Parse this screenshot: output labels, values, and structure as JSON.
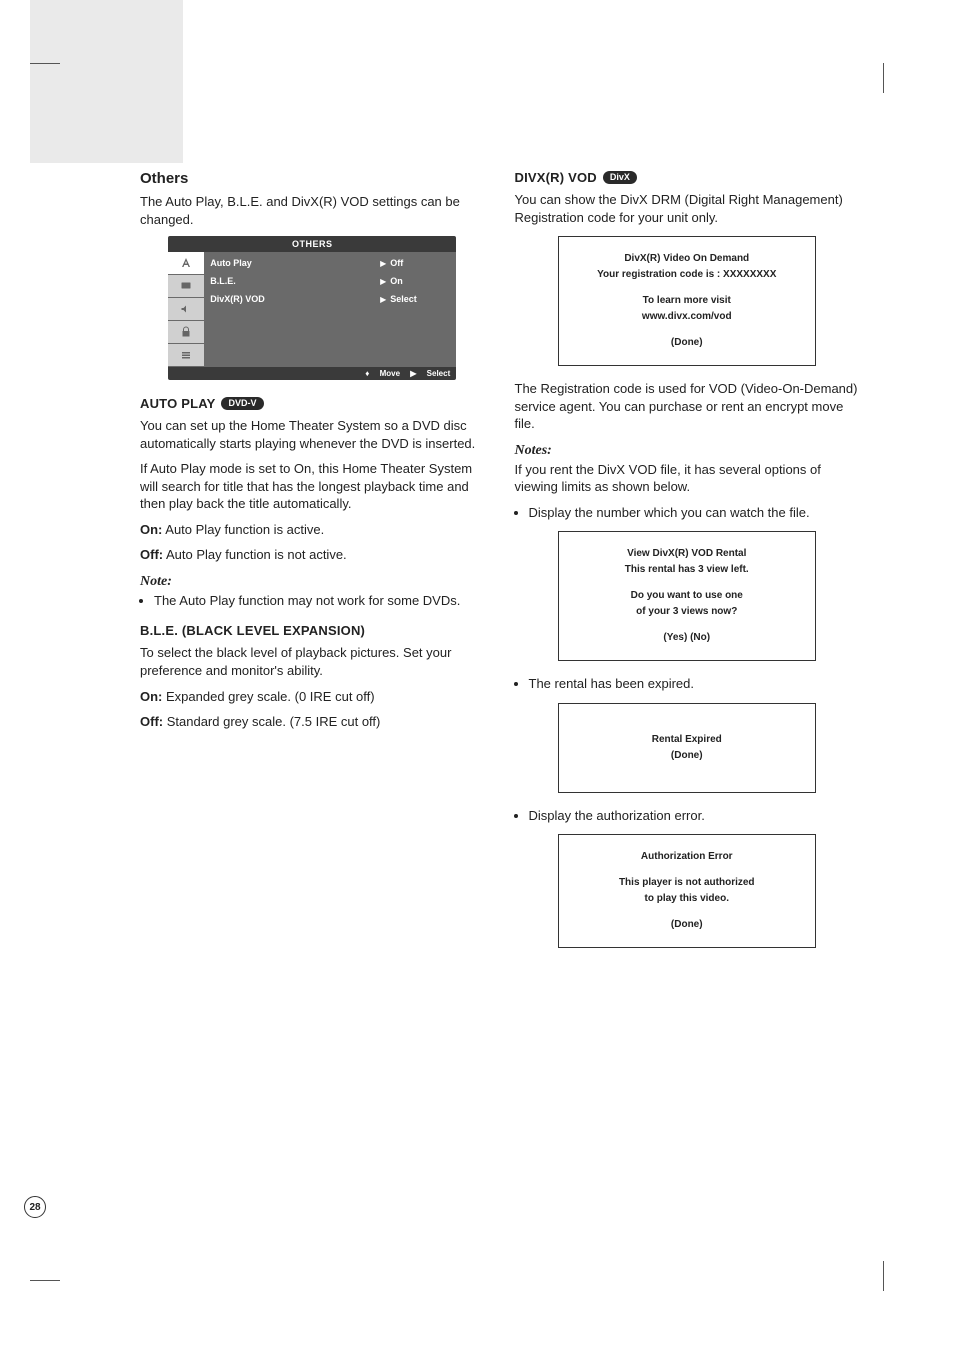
{
  "page_number": "28",
  "left": {
    "heading": "Others",
    "intro": "The Auto Play, B.L.E. and DivX(R) VOD settings can be changed.",
    "menu": {
      "title": "OTHERS",
      "rows": [
        {
          "name": "Auto Play",
          "value": "Off"
        },
        {
          "name": "B.L.E.",
          "value": "On"
        },
        {
          "name": "DivX(R) VOD",
          "value": "Select"
        }
      ],
      "footer_move": "Move",
      "footer_select": "Select"
    },
    "autoplay": {
      "title": "AUTO PLAY",
      "badge": "DVD-V",
      "p1": "You can set up the Home Theater System so a DVD disc automatically starts playing whenever the DVD is inserted.",
      "p2": "If Auto Play mode is set to On, this Home Theater System will search for title that has the longest playback time and then play back the title automatically.",
      "on_label": "On:",
      "on_text": " Auto Play function is active.",
      "off_label": "Off:",
      "off_text": " Auto Play function is not active.",
      "note_hd": "Note:",
      "note_item": "The Auto Play function may not work for some DVDs."
    },
    "ble": {
      "title": "B.L.E. (BLACK LEVEL EXPANSION)",
      "p1": "To select the black level of playback pictures. Set your preference and monitor's ability.",
      "on_label": "On:",
      "on_text": " Expanded grey scale. (0 IRE cut off)",
      "off_label": "Off:",
      "off_text": " Standard grey scale. (7.5 IRE cut off)"
    }
  },
  "right": {
    "divx": {
      "title": "DIVX(R) VOD",
      "badge": "DivX",
      "p1": "You can show the DivX DRM (Digital Right Management) Registration code for your unit only.",
      "box1_l1": "DivX(R) Video On Demand",
      "box1_l2": "Your registration code is : XXXXXXXX",
      "box1_l3": "To learn more visit",
      "box1_l4": "www.divx.com/vod",
      "box1_l5": "(Done)",
      "p2": "The Registration code is used for VOD (Video-On-Demand) service agent. You can purchase or rent an encrypt move file.",
      "notes_hd": "Notes:",
      "notes_intro": "If you rent the DivX VOD file, it has several options of viewing limits as shown below.",
      "bullet1": "Display the number which you can watch the file.",
      "box2_l1": "View DivX(R) VOD Rental",
      "box2_l2": "This rental has 3 view left.",
      "box2_l3": "Do you want to use one",
      "box2_l4": "of your 3 views now?",
      "box2_l5": "(Yes) (No)",
      "bullet2": "The rental has been expired.",
      "box3_l1": "Rental Expired",
      "box3_l2": "(Done)",
      "bullet3": "Display the authorization error.",
      "box4_l1": "Authorization Error",
      "box4_l2": "This player is not authorized",
      "box4_l3": "to play this video.",
      "box4_l4": "(Done)"
    }
  }
}
